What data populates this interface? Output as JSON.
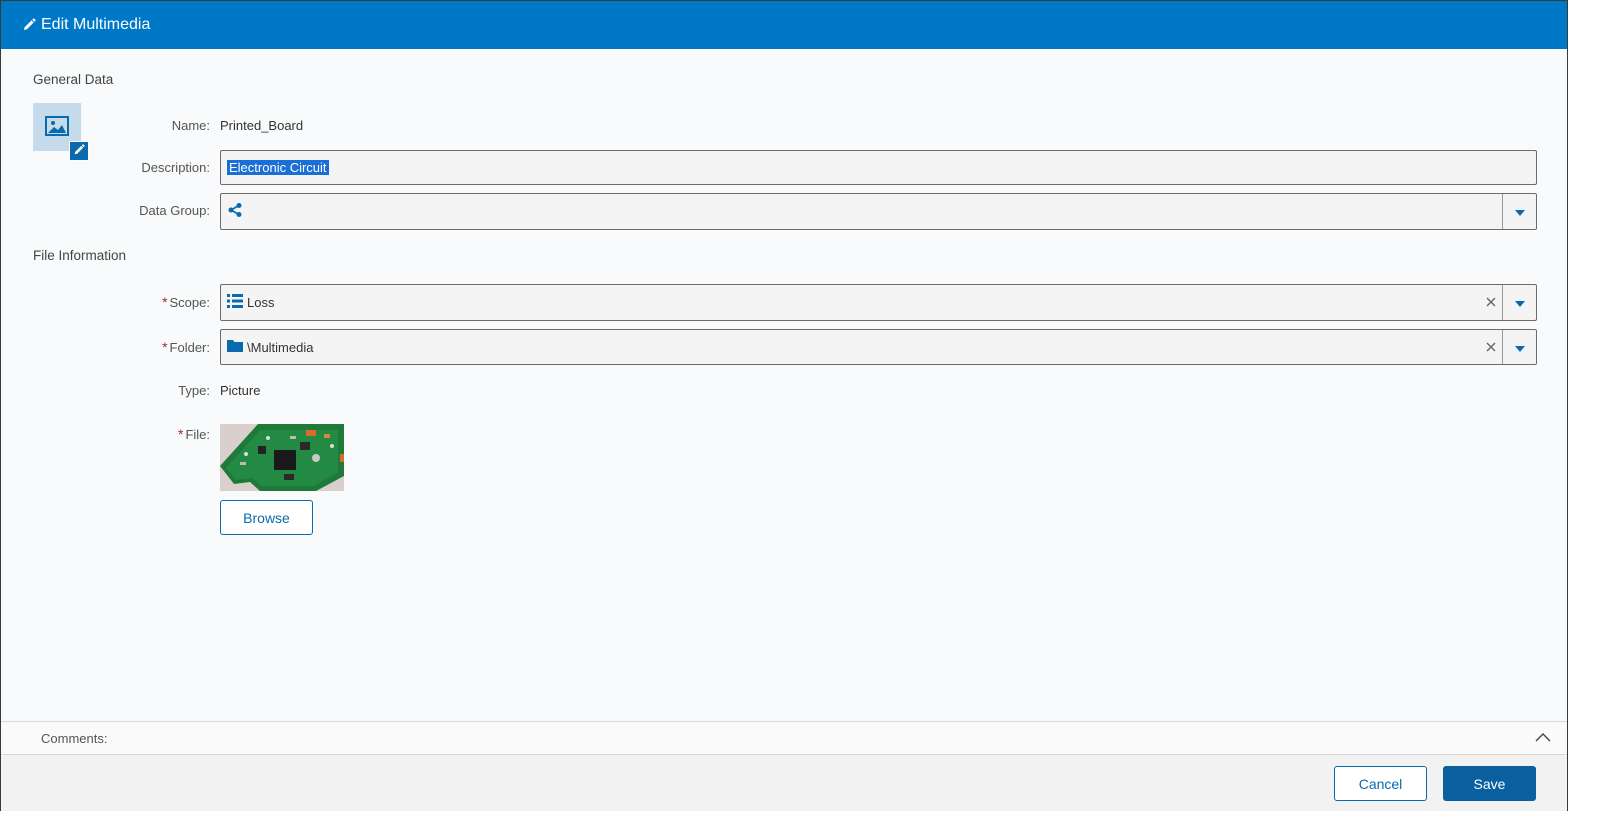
{
  "dialog": {
    "title": "Edit Multimedia",
    "title_icon": "pencil-icon",
    "accent_color": "#0078c8"
  },
  "general": {
    "section_title": "General Data",
    "name_label": "Name:",
    "name_value": "Printed_Board",
    "description_label": "Description:",
    "description_value": "Electronic Circuit",
    "data_group_label": "Data Group:",
    "data_group_icon": "share-nodes-icon"
  },
  "file_info": {
    "section_title": "File Information",
    "scope_label": "Scope:",
    "scope_value": "Loss",
    "scope_icon": "list-icon",
    "folder_label": "Folder:",
    "folder_value": "\\Multimedia",
    "folder_icon": "folder-icon",
    "type_label": "Type:",
    "type_value": "Picture",
    "file_label": "File:",
    "required_marker": "*",
    "browse_label": "Browse"
  },
  "comments": {
    "label": "Comments:"
  },
  "footer": {
    "cancel_label": "Cancel",
    "save_label": "Save"
  }
}
